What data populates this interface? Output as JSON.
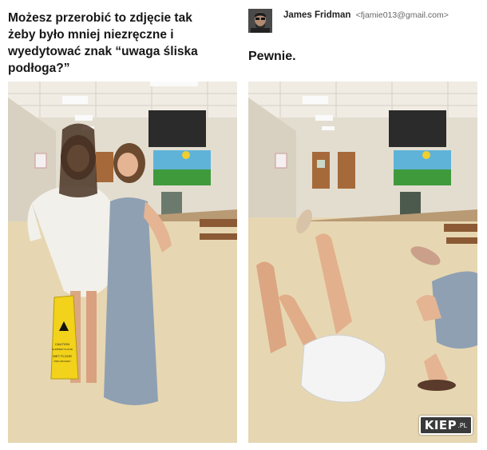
{
  "question": {
    "lines": [
      "Możesz przerobić to zdjęcie tak",
      "żeby było mniej niezręczne i",
      "wyedytować znak “uwaga śliska",
      "podłoga?”"
    ]
  },
  "reply": {
    "sender_name": "James Fridman",
    "sender_email": "<fjamie013@gmail.com>",
    "text": "Pewnie."
  },
  "sign_text": [
    "CAUTION",
    "SLIPPERY FLOOR",
    "WET FLOOR",
    "PISO MOJADO"
  ],
  "watermark": {
    "text": "KIEP",
    "suffix": ".PL"
  },
  "colors": {
    "floor": "#e6d7b2",
    "wall": "#e3ddd0",
    "ceiling": "#f2eee6",
    "sign_yellow": "#f2d21a",
    "dress_gray": "#8fa0b3",
    "shorts_white": "#f4f4f4"
  }
}
